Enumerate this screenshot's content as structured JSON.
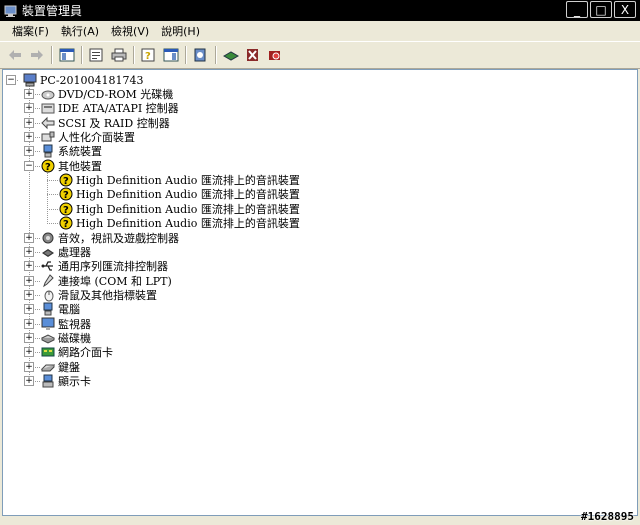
{
  "window": {
    "title": "裝置管理員",
    "buttons": [
      "_",
      "□",
      "X"
    ]
  },
  "menu": [
    {
      "label": "檔案(F)"
    },
    {
      "label": "執行(A)"
    },
    {
      "label": "檢視(V)"
    },
    {
      "label": "說明(H)"
    }
  ],
  "tree": {
    "root": "PC-201004181743",
    "categories": [
      {
        "label": "DVD/CD-ROM 光碟機",
        "icon": "cdrom-icon"
      },
      {
        "label": "IDE ATA/ATAPI 控制器",
        "icon": "ide-controller-icon"
      },
      {
        "label": "SCSI 及 RAID 控制器",
        "icon": "scsi-icon"
      },
      {
        "label": "人性化介面裝置",
        "icon": "hid-icon"
      },
      {
        "label": "系統裝置",
        "icon": "computer-icon"
      },
      {
        "label": "其他裝置",
        "icon": "unknown-device-icon"
      },
      {
        "label": "音效，視訊及遊戲控制器",
        "icon": "audio-icon"
      },
      {
        "label": "處理器",
        "icon": "processor-icon"
      },
      {
        "label": "通用序列匯流排控制器",
        "icon": "usb-icon"
      },
      {
        "label": "連接埠 (COM 和 LPT)",
        "icon": "port-icon"
      },
      {
        "label": "滑鼠及其他指標裝置",
        "icon": "mouse-icon"
      },
      {
        "label": "電腦",
        "icon": "computer-icon"
      },
      {
        "label": "監視器",
        "icon": "monitor-icon"
      },
      {
        "label": "磁碟機",
        "icon": "disk-icon"
      },
      {
        "label": "網路介面卡",
        "icon": "network-icon"
      },
      {
        "label": "鍵盤",
        "icon": "keyboard-icon"
      },
      {
        "label": "顯示卡",
        "icon": "display-icon"
      }
    ],
    "other_devices": [
      "High Definition Audio 匯流排上的音訊裝置",
      "High Definition Audio 匯流排上的音訊裝置",
      "High Definition Audio 匯流排上的音訊裝置",
      "High Definition Audio 匯流排上的音訊裝置"
    ]
  },
  "watermark": "#1628895"
}
